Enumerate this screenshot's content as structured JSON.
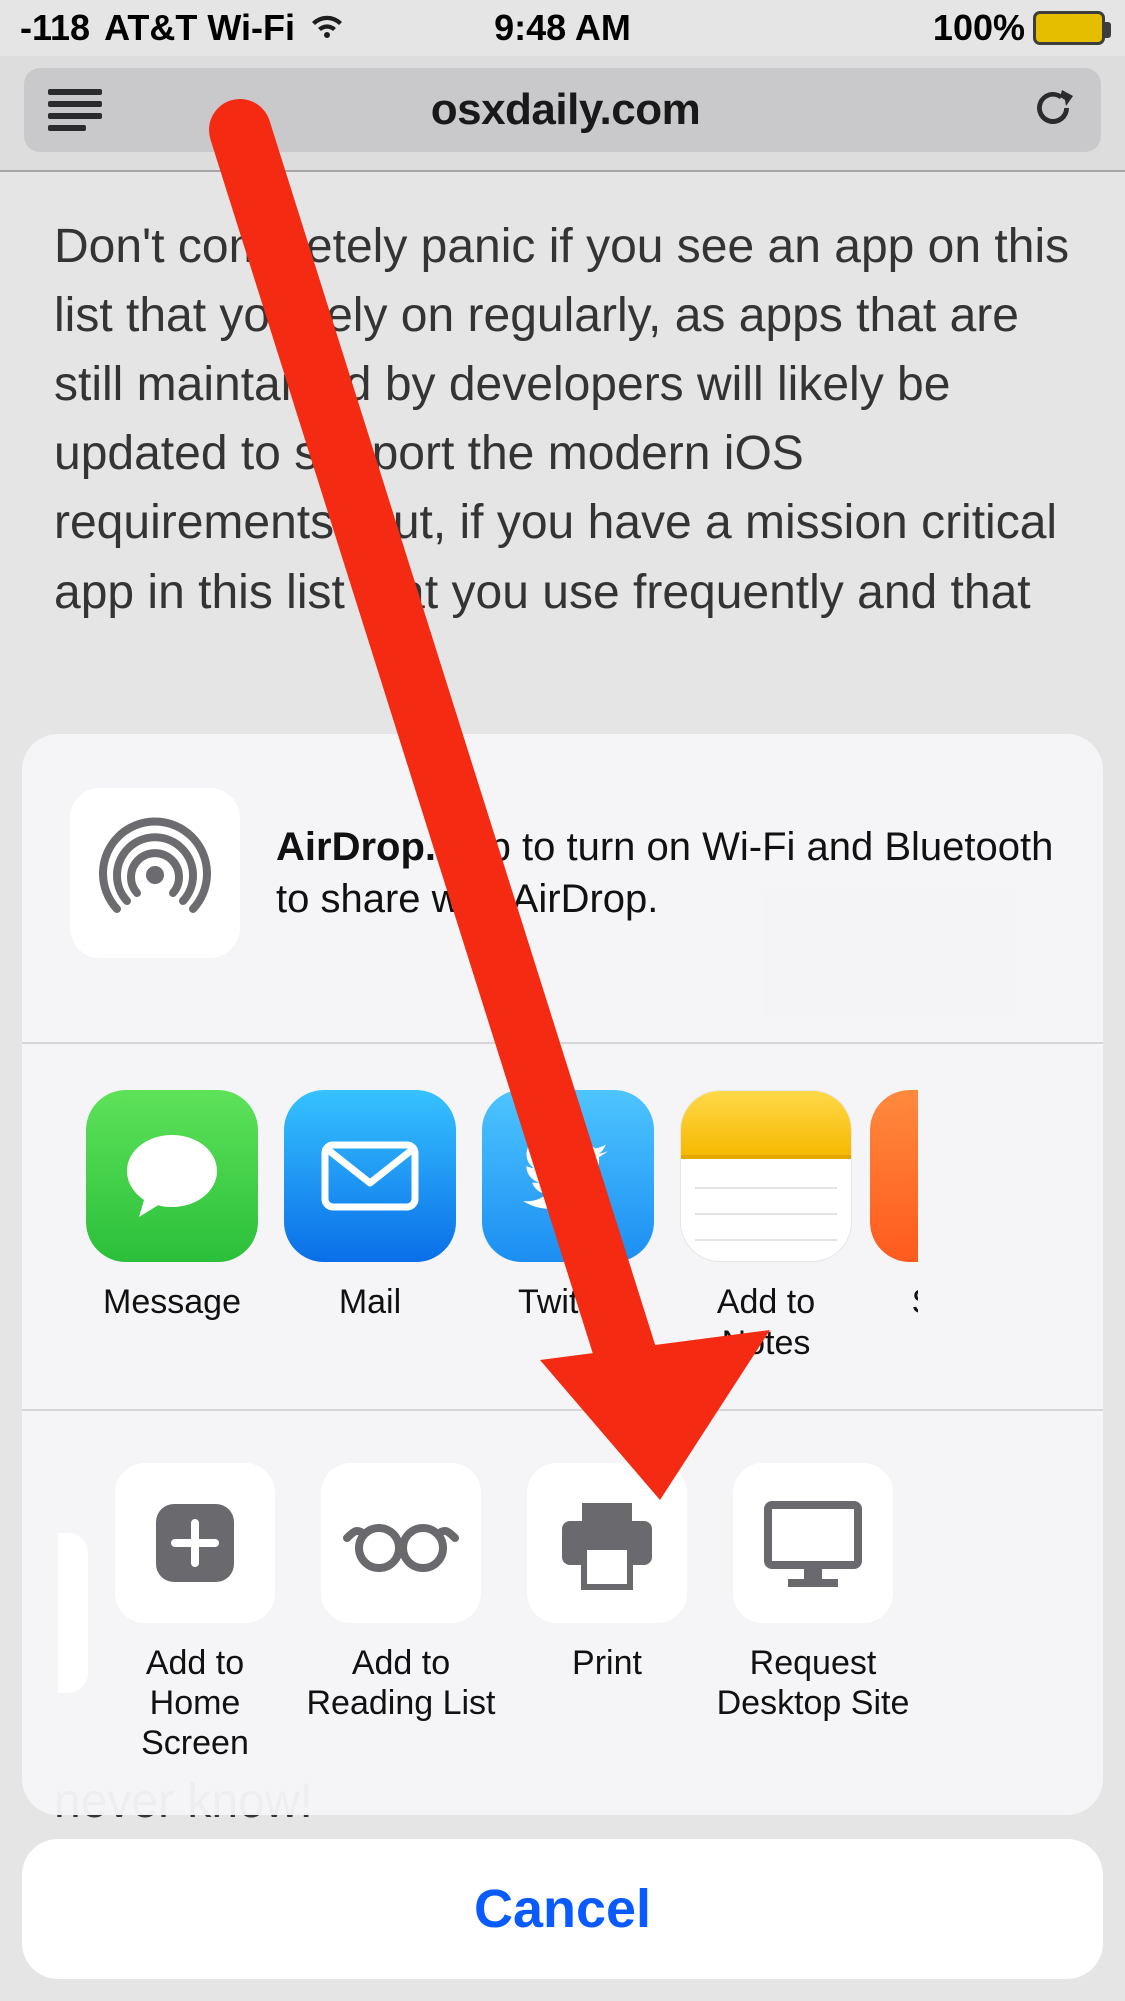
{
  "status": {
    "signal": "-118",
    "carrier": "AT&T Wi-Fi",
    "time": "9:48 AM",
    "battery_pct": "100%"
  },
  "safari": {
    "domain": "osxdaily.com"
  },
  "page": {
    "paragraph": "Don't completely panic if you see an app on this list that you rely on regularly, as apps that are still maintained by developers will likely be updated to support the modern iOS requirements. But, if you have a mission critical app in this list that you use frequently and that",
    "tail": "never know!"
  },
  "share": {
    "airdrop_bold": "AirDrop.",
    "airdrop_rest": " Tap to turn on Wi-Fi and Bluetooth to share with AirDrop.",
    "apps": [
      {
        "label": "Message"
      },
      {
        "label": "Mail"
      },
      {
        "label": "Twitter"
      },
      {
        "label": "Add to Notes"
      },
      {
        "label": "Safari"
      }
    ],
    "actions": [
      {
        "label": "Add to\nHome Screen"
      },
      {
        "label": "Add to\nReading List"
      },
      {
        "label": "Print"
      },
      {
        "label": "Request\nDesktop Site"
      }
    ],
    "cancel": "Cancel"
  }
}
